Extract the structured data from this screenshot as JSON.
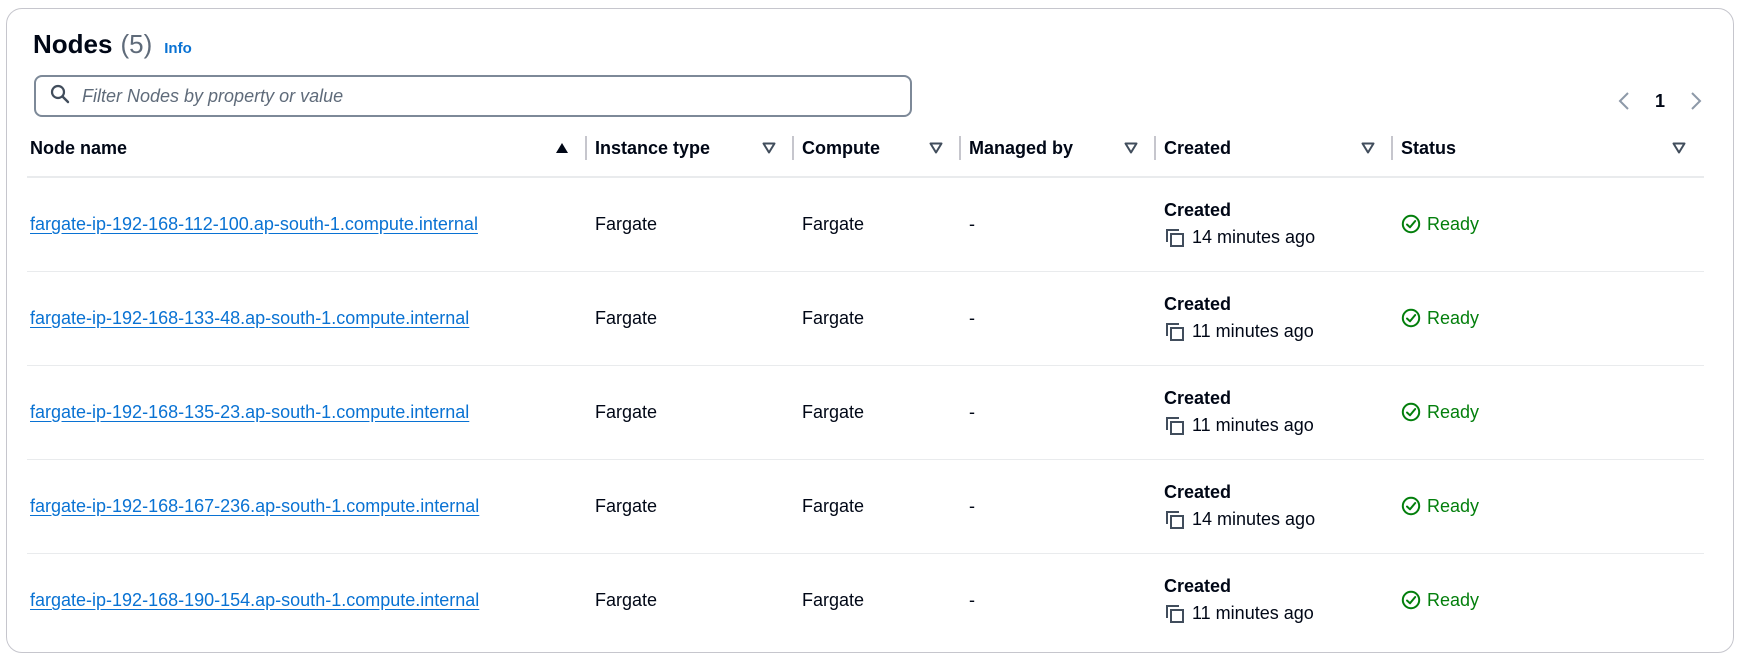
{
  "header": {
    "title": "Nodes",
    "count": "(5)",
    "info_link": "Info"
  },
  "search": {
    "placeholder": "Filter Nodes by property or value",
    "value": ""
  },
  "pagination": {
    "current_page": "1"
  },
  "columns": [
    {
      "label": "Node name",
      "sort": "ascending"
    },
    {
      "label": "Instance type",
      "sort": "none"
    },
    {
      "label": "Compute",
      "sort": "none"
    },
    {
      "label": "Managed by",
      "sort": "none"
    },
    {
      "label": "Created",
      "sort": "none"
    },
    {
      "label": "Status",
      "sort": "none"
    }
  ],
  "rows": [
    {
      "node_name": "fargate-ip-192-168-112-100.ap-south-1.compute.internal",
      "instance_type": "Fargate",
      "compute": "Fargate",
      "managed_by": "-",
      "created_label": "Created",
      "created": "14 minutes ago",
      "status": "Ready"
    },
    {
      "node_name": "fargate-ip-192-168-133-48.ap-south-1.compute.internal",
      "instance_type": "Fargate",
      "compute": "Fargate",
      "managed_by": "-",
      "created_label": "Created",
      "created": "11 minutes ago",
      "status": "Ready"
    },
    {
      "node_name": "fargate-ip-192-168-135-23.ap-south-1.compute.internal",
      "instance_type": "Fargate",
      "compute": "Fargate",
      "managed_by": "-",
      "created_label": "Created",
      "created": "11 minutes ago",
      "status": "Ready"
    },
    {
      "node_name": "fargate-ip-192-168-167-236.ap-south-1.compute.internal",
      "instance_type": "Fargate",
      "compute": "Fargate",
      "managed_by": "-",
      "created_label": "Created",
      "created": "14 minutes ago",
      "status": "Ready"
    },
    {
      "node_name": "fargate-ip-192-168-190-154.ap-south-1.compute.internal",
      "instance_type": "Fargate",
      "compute": "Fargate",
      "managed_by": "-",
      "created_label": "Created",
      "created": "11 minutes ago",
      "status": "Ready"
    }
  ],
  "colors": {
    "link": "#0972d3",
    "status_ready": "#037f0c",
    "text": "#000716",
    "muted": "#5f6b7a",
    "border": "#c6c6cd"
  },
  "icons": {
    "search": "search-icon",
    "prev": "chevron-left-icon",
    "next": "chevron-right-icon",
    "sort_asc": "caret-up-filled-icon",
    "sort_none": "caret-down-outline-icon",
    "copy": "copy-icon",
    "status": "check-circle-icon"
  }
}
